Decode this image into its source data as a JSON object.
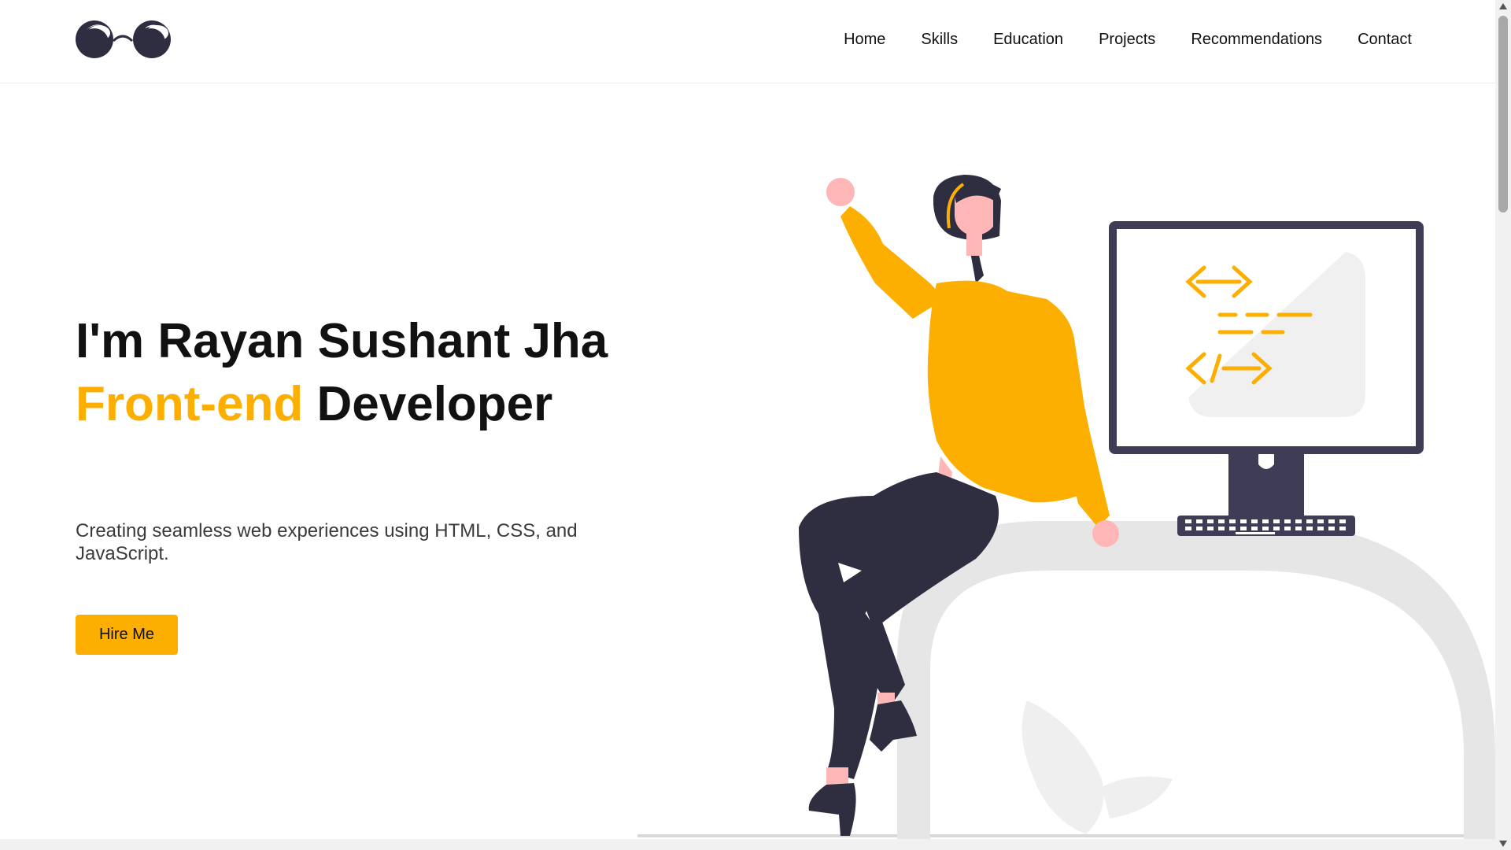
{
  "header": {
    "logo_icon": "glasses-logo-icon",
    "nav": [
      {
        "label": "Home"
      },
      {
        "label": "Skills"
      },
      {
        "label": "Education"
      },
      {
        "label": "Projects"
      },
      {
        "label": "Recommendations"
      },
      {
        "label": "Contact"
      }
    ]
  },
  "hero": {
    "title_prefix": "I'm Rayan Sushant Jha",
    "role_accent": "Front-end",
    "role_rest": " Developer",
    "subtitle": "Creating seamless web experiences using HTML, CSS, and JavaScript.",
    "cta_label": "Hire Me",
    "illustration_icon": "developer-at-desk-illustration"
  },
  "colors": {
    "accent": "#fcaf00",
    "text": "#111111",
    "dark": "#2f2e41",
    "skin": "#ffb6b6",
    "light_gray": "#e6e6e6"
  }
}
